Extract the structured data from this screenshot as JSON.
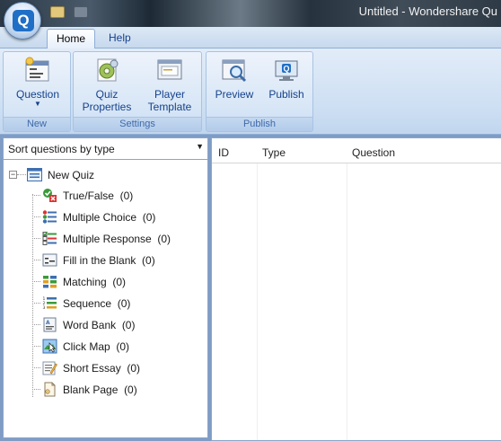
{
  "window": {
    "title": "Untitled - Wondershare Qu"
  },
  "app_button": {
    "letter": "Q"
  },
  "tabs": [
    {
      "label": "Home",
      "active": true
    },
    {
      "label": "Help",
      "active": false
    }
  ],
  "ribbon": {
    "groups": [
      {
        "label": "New",
        "buttons": [
          {
            "label": "Question",
            "icon": "question-icon",
            "has_dropdown": true
          }
        ]
      },
      {
        "label": "Settings",
        "buttons": [
          {
            "label_line1": "Quiz",
            "label_line2": "Properties",
            "icon": "gear-icon"
          },
          {
            "label_line1": "Player",
            "label_line2": "Template",
            "icon": "player-template-icon"
          }
        ]
      },
      {
        "label": "Publish",
        "buttons": [
          {
            "label": "Preview",
            "icon": "preview-icon"
          },
          {
            "label": "Publish",
            "icon": "publish-icon"
          }
        ]
      }
    ]
  },
  "left_panel": {
    "sort_select": {
      "value": "Sort questions by type"
    },
    "tree": {
      "root": {
        "label": "New Quiz",
        "expander": "−"
      },
      "items": [
        {
          "label": "True/False",
          "count": "(0)",
          "icon": "true-false-icon"
        },
        {
          "label": "Multiple Choice",
          "count": "(0)",
          "icon": "multiple-choice-icon"
        },
        {
          "label": "Multiple Response",
          "count": "(0)",
          "icon": "multiple-response-icon"
        },
        {
          "label": "Fill in the Blank",
          "count": "(0)",
          "icon": "fill-blank-icon"
        },
        {
          "label": "Matching",
          "count": "(0)",
          "icon": "matching-icon"
        },
        {
          "label": "Sequence",
          "count": "(0)",
          "icon": "sequence-icon"
        },
        {
          "label": "Word Bank",
          "count": "(0)",
          "icon": "word-bank-icon"
        },
        {
          "label": "Click Map",
          "count": "(0)",
          "icon": "click-map-icon"
        },
        {
          "label": "Short Essay",
          "count": "(0)",
          "icon": "short-essay-icon"
        },
        {
          "label": "Blank Page",
          "count": "(0)",
          "icon": "blank-page-icon"
        }
      ]
    }
  },
  "question_list": {
    "columns": [
      "ID",
      "Type",
      "Question"
    ],
    "rows": []
  }
}
